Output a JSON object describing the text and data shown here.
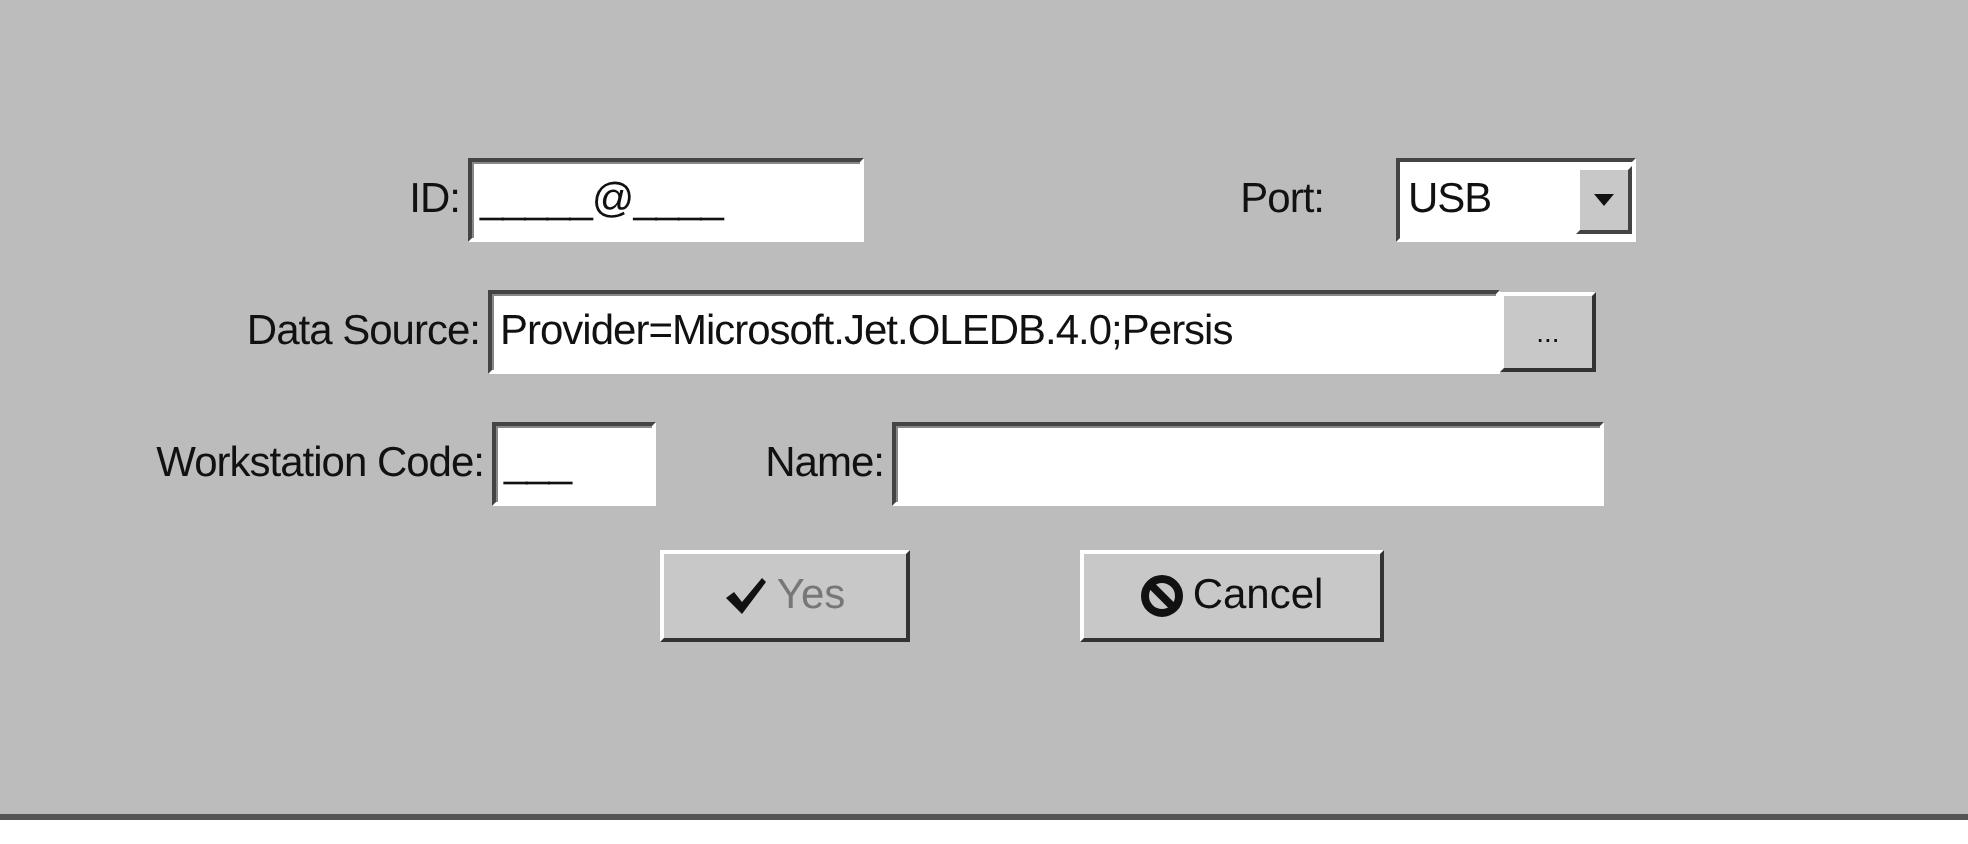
{
  "fields": [
    {
      "kind": "id",
      "label": "ID:",
      "value": "_____@____"
    },
    {
      "kind": "port",
      "label": "Port:",
      "value": "USB"
    },
    {
      "kind": "source",
      "label": "Data Source:",
      "value": "Provider=Microsoft.Jet.OLEDB.4.0;Persis",
      "browse": "..."
    },
    {
      "kind": "code",
      "label": "Workstation Code:",
      "value": "___"
    },
    {
      "kind": "name",
      "label": "Name:"
    }
  ],
  "buttons": [
    {
      "kind": "ok",
      "label": "Yes",
      "disabled": true
    },
    {
      "kind": "cancel",
      "label": "Cancel",
      "disabled": false
    }
  ]
}
